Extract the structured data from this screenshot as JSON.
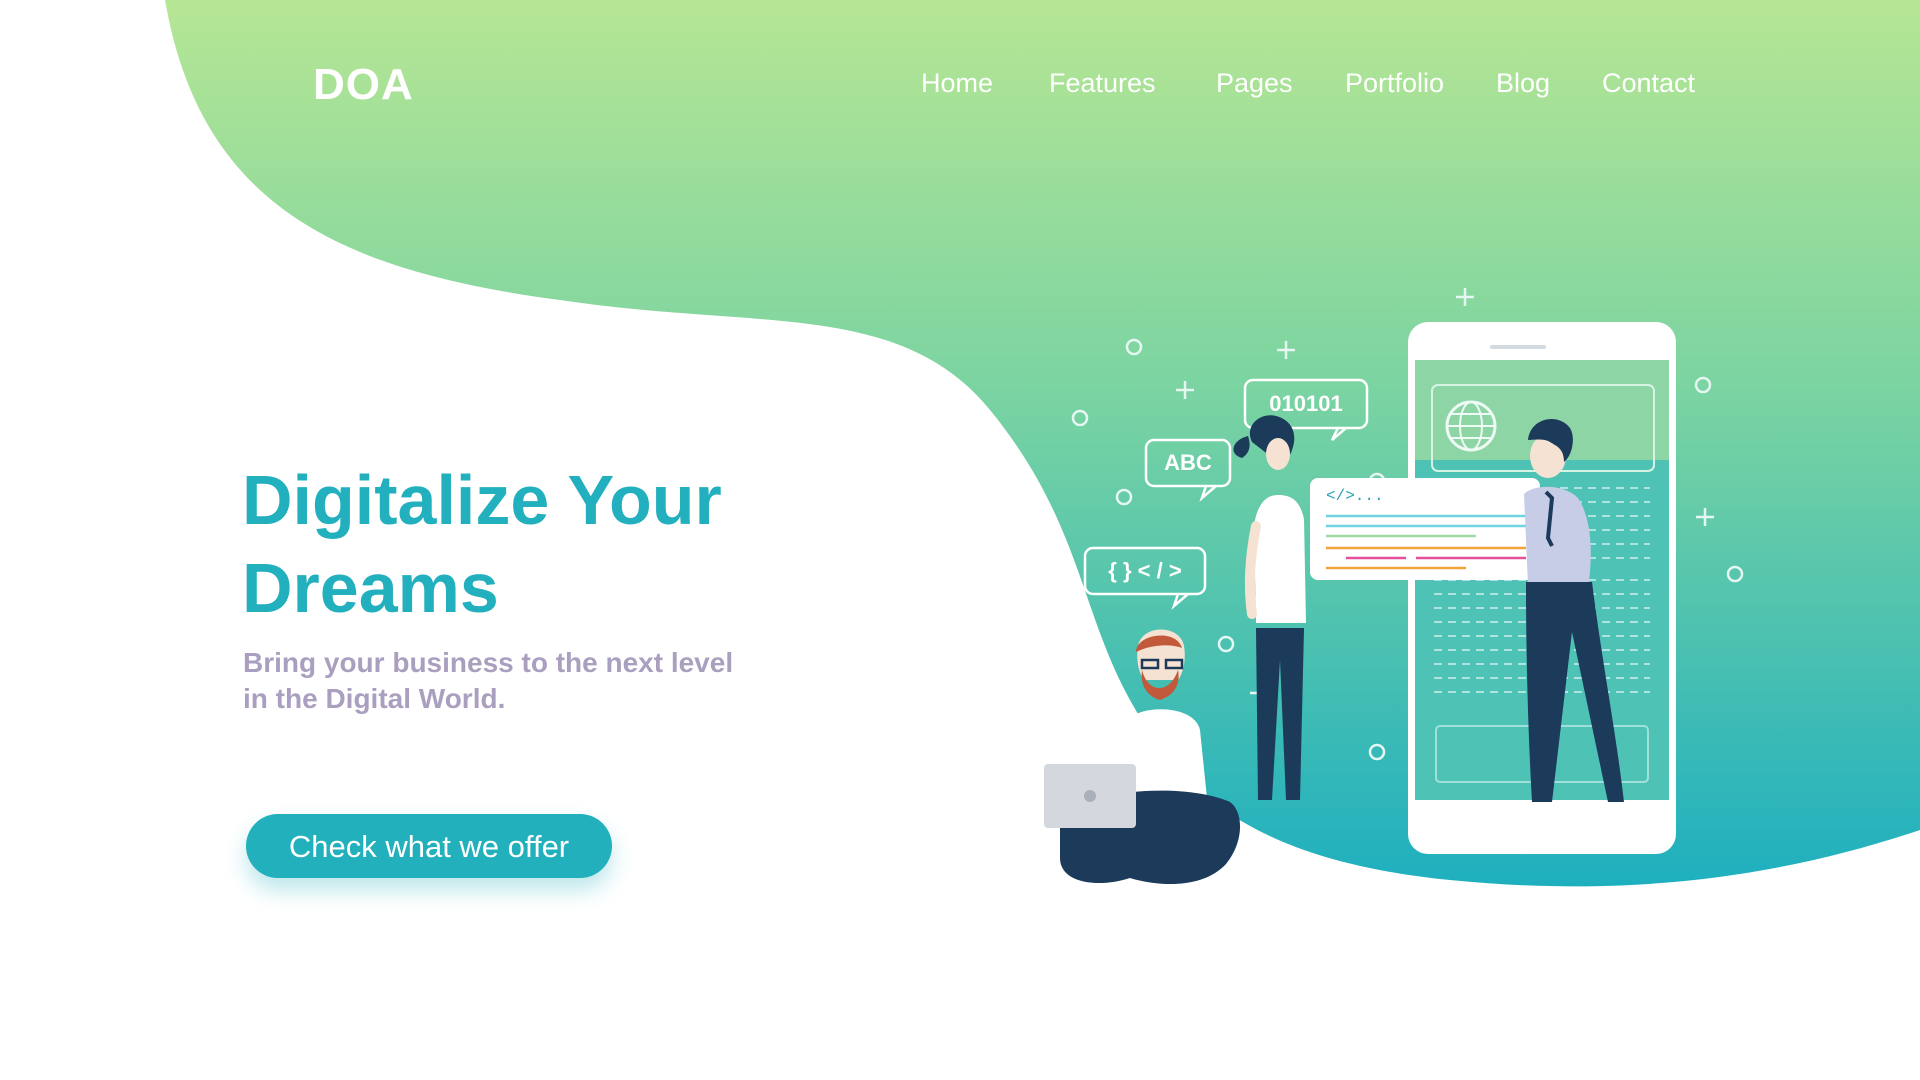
{
  "brand": {
    "logo_text": "DOA"
  },
  "nav": {
    "items": [
      {
        "label": "Home"
      },
      {
        "label": "Features"
      },
      {
        "label": "Pages"
      },
      {
        "label": "Portfolio"
      },
      {
        "label": "Blog"
      },
      {
        "label": "Contact"
      }
    ]
  },
  "hero": {
    "title_line1": "Digitalize Your",
    "title_line2": "Dreams",
    "subtitle_line1": "Bring your business to the next level",
    "subtitle_line2": "in the Digital World.",
    "cta_label": "Check what we offer"
  },
  "illustration": {
    "bubble_binary": "010101",
    "bubble_abc": "ABC",
    "bubble_code": "{ } < / >",
    "card_code": "</>..."
  },
  "colors": {
    "gradient_top": "#b5e694",
    "gradient_bottom": "#1fb0bf",
    "accent": "#23b0be",
    "subtitle": "#ab9fc0",
    "navy": "#1c3a5a"
  }
}
